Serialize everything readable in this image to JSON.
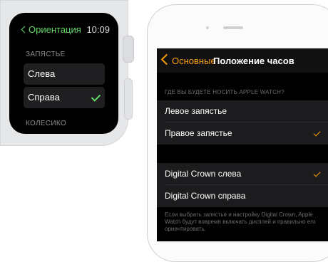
{
  "watch": {
    "back_label": "Ориентация",
    "time": "10:09",
    "section_title": "ЗАПЯСТЬЕ",
    "options": [
      {
        "label": "Слева",
        "selected": false
      },
      {
        "label": "Справа",
        "selected": true
      }
    ],
    "next_section_title": "КОЛЕСИКО",
    "accent_color": "#64d868"
  },
  "phone": {
    "nav": {
      "back_label": "Основные",
      "title": "Положение часов"
    },
    "wrist_section_header": "ГДЕ ВЫ БУДЕТЕ НОСИТЬ APPLE WATCH?",
    "wrist_options": [
      {
        "label": "Левое запястье",
        "selected": false
      },
      {
        "label": "Правое запястье",
        "selected": true
      }
    ],
    "crown_options": [
      {
        "label": "Digital Crown слева",
        "selected": true
      },
      {
        "label": "Digital Crown справа",
        "selected": false
      }
    ],
    "footer_note": "Если выбрать запястье и настройку Digital Crown, Apple Watch будут вовремя включать дисплей и правильно его ориентировать.",
    "accent_color": "#ff9f0a"
  }
}
